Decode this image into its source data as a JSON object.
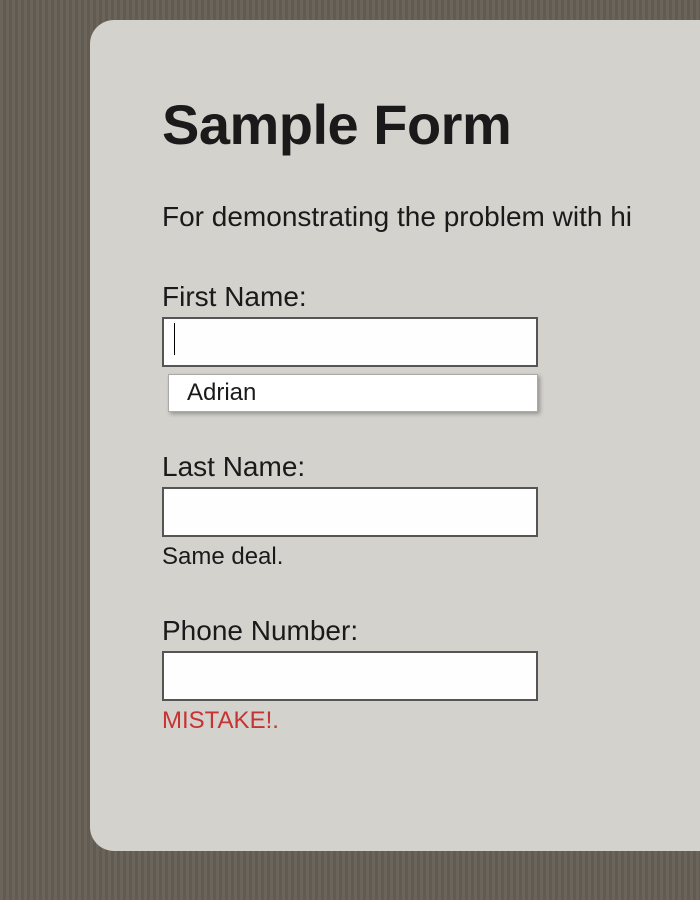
{
  "form": {
    "title": "Sample Form",
    "subtitle": "For demonstrating the problem with hi",
    "fields": {
      "first_name": {
        "label": "First Name:",
        "value": "",
        "autocomplete_suggestion": "Adrian"
      },
      "last_name": {
        "label": "Last Name:",
        "value": "",
        "hint": "Same deal."
      },
      "phone": {
        "label": "Phone Number:",
        "value": "",
        "error": "MISTAKE!."
      }
    }
  }
}
